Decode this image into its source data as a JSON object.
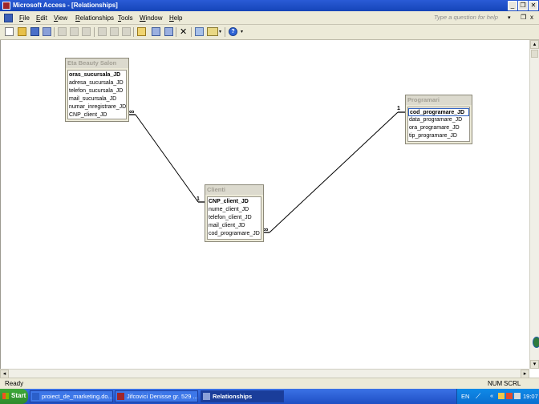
{
  "window": {
    "title": "Microsoft Access - [Relationships]",
    "min": "_",
    "max": "❐",
    "close": "✕"
  },
  "menu": {
    "items": [
      {
        "label": "File"
      },
      {
        "label": "Edit"
      },
      {
        "label": "View"
      },
      {
        "label": "Relationships"
      },
      {
        "label": "Tools"
      },
      {
        "label": "Window"
      },
      {
        "label": "Help"
      }
    ],
    "help_placeholder": "Type a question for help",
    "doc_close": "x"
  },
  "tables": {
    "eta": {
      "title": "Eta Beauty Salon",
      "fields": [
        "oras_sucursala_JD",
        "adresa_sucursala_JD",
        "telefon_sucursala_JD",
        "mail_sucursala_JD",
        "numar_inregistrare_JD",
        "CNP_client_JD"
      ]
    },
    "programari": {
      "title": "Programari",
      "fields": [
        "cod_programare_JD",
        "data_programare_JD",
        "ora_programare_JD",
        "tip_programare_JD"
      ]
    },
    "clienti": {
      "title": "Clienti",
      "fields": [
        "CNP_client_JD",
        "nume_client_JD",
        "telefon_client_JD",
        "mail_client_JD",
        "cod_programare_JD"
      ]
    }
  },
  "relations": {
    "one": "1",
    "many": "∞"
  },
  "status": {
    "left": "Ready",
    "num": "NUM",
    "scrl": "SCRL"
  },
  "taskbar": {
    "start": "Start",
    "tasks": [
      {
        "label": "proiect_de_marketing.do..."
      },
      {
        "label": "Jifcovici Denisse gr. 529 ..."
      },
      {
        "label": "Relationships"
      }
    ],
    "lang": "EN",
    "clock": "19:07"
  },
  "colors": {
    "titlebar": "#1f4fc4",
    "taskbar": "#2a5bd6",
    "start": "#3ea93b",
    "tray": "#0f8ae8"
  }
}
